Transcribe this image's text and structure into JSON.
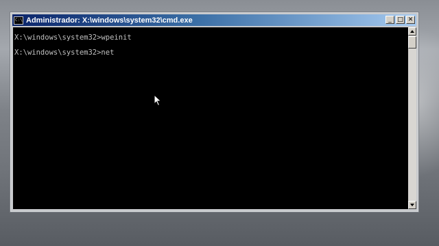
{
  "window": {
    "title": "Administrador: X:\\windows\\system32\\cmd.exe",
    "icon_label": "C:\\",
    "icon": "console-icon",
    "buttons": {
      "minimize": "_",
      "maximize": "□",
      "close": "✕"
    }
  },
  "console": {
    "lines": [
      "X:\\windows\\system32>wpeinit",
      "X:\\windows\\system32>net"
    ],
    "text_color": "#c0c0c0",
    "background": "#000000"
  },
  "scrollbar": {
    "up_icon": "arrow-up-icon",
    "down_icon": "arrow-down-icon"
  },
  "pointer": {
    "icon": "mouse-pointer-icon"
  },
  "colors": {
    "titlebar_start": "#0a246a",
    "titlebar_end": "#a6caf0",
    "frame": "#c7c9cc"
  }
}
